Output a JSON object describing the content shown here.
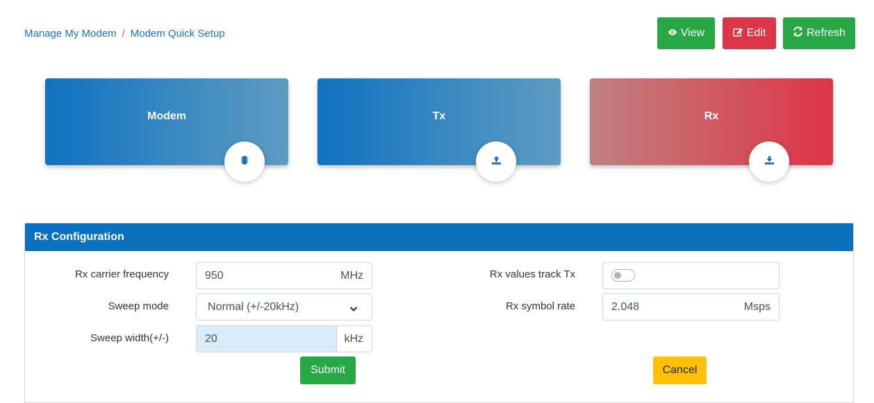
{
  "breadcrumb": {
    "root": "Manage My Modem",
    "separator": "/",
    "current": "Modem Quick Setup"
  },
  "toolbar": {
    "view_label": "View",
    "edit_label": "Edit",
    "refresh_label": "Refresh"
  },
  "cards": {
    "modem": {
      "title": "Modem",
      "icon": "chip-icon"
    },
    "tx": {
      "title": "Tx",
      "icon": "upload-icon"
    },
    "rx": {
      "title": "Rx",
      "icon": "download-icon"
    }
  },
  "panel": {
    "title": "Rx Configuration",
    "rx_carrier_frequency": {
      "label": "Rx carrier frequency",
      "value": "950",
      "unit": "MHz"
    },
    "sweep_mode": {
      "label": "Sweep mode",
      "value": "Normal (+/-20kHz)"
    },
    "sweep_width": {
      "label": "Sweep width(+/-)",
      "value": "20",
      "unit": "kHz"
    },
    "rx_values_track_tx": {
      "label": "Rx values track Tx",
      "checked": false
    },
    "rx_symbol_rate": {
      "label": "Rx symbol rate",
      "value": "2.048",
      "unit": "Msps"
    },
    "submit_label": "Submit",
    "cancel_label": "Cancel"
  },
  "colors": {
    "primary": "#0a71bf",
    "success": "#28a745",
    "danger": "#dc3545",
    "warning": "#ffc107",
    "link": "#1a73c9"
  }
}
